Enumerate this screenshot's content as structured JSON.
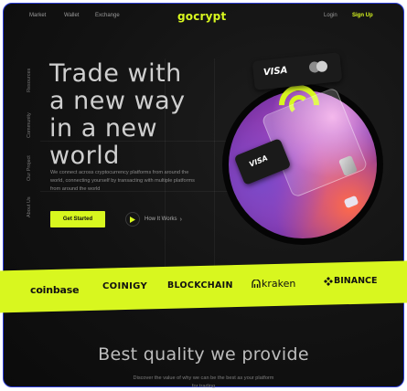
{
  "nav": {
    "links": [
      "Market",
      "Wallet",
      "Exchange"
    ],
    "logo": "gocrypt",
    "login": "Login",
    "signup": "Sign Up"
  },
  "side_labels": [
    "Resources",
    "Community",
    "Our Project",
    "About Us"
  ],
  "hero": {
    "title_lines": [
      "Trade with",
      "a new way",
      "in a new",
      "world"
    ],
    "description": "We connect across cryptocurrency platforms from around the world, connecting yourself by transacting with multiple platforms from around the world",
    "cta_label": "Get Started",
    "secondary_label": "How It Works",
    "card_brand": "VISA",
    "card_brand_small": "VISA"
  },
  "partners": [
    "coinbase",
    "COINIGY",
    "BLOCKCHAIN",
    "kraken",
    "BINANCE"
  ],
  "quality": {
    "title": "Best quality we provide",
    "description": "Discover the value of why we can be the best as your platform for trading"
  },
  "colors": {
    "accent": "#d8f71f",
    "background": "#121212",
    "frame_border": "#2a3bd6"
  },
  "icons": [
    "play-icon",
    "chevron-right-icon",
    "mastercard-icon",
    "kraken-icon",
    "binance-icon"
  ]
}
